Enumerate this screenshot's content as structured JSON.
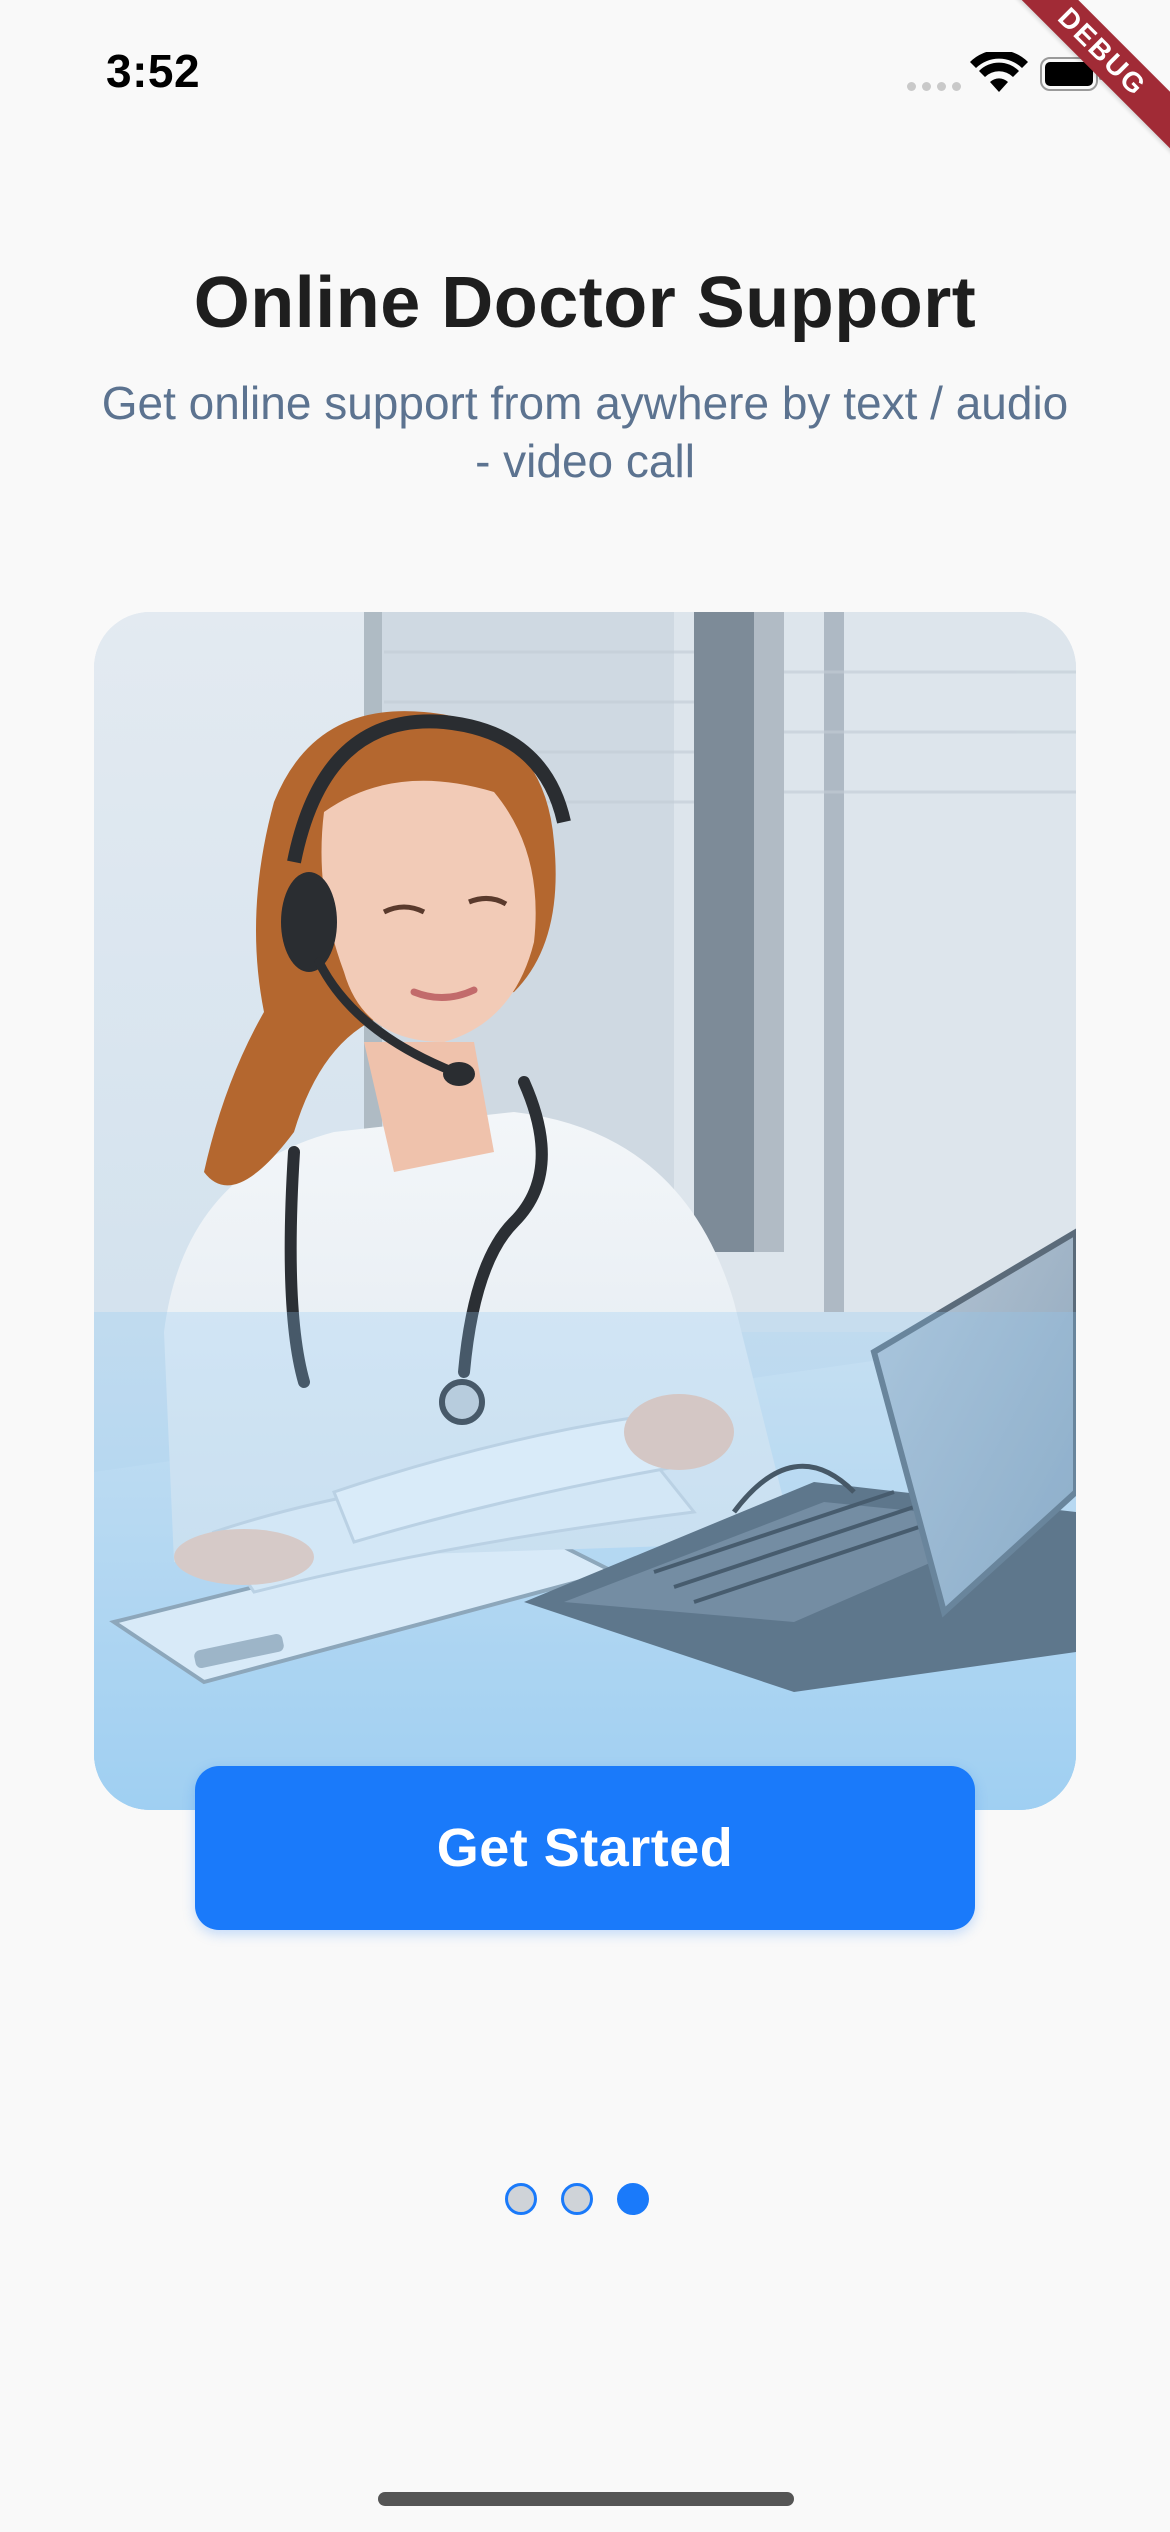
{
  "status_bar": {
    "time": "3:52"
  },
  "debug_banner": {
    "label": "DEBUG"
  },
  "onboarding": {
    "title": "Online Doctor Support",
    "subtitle": "Get online support from aywhere by text / audio - video call",
    "hero_image": "doctor-with-headset-at-laptop-illustration",
    "button_label": "Get Started",
    "page_indicator": {
      "total_pages": 3,
      "current_page": 3
    }
  },
  "colors": {
    "background": "#f9f9f9",
    "accent": "#1a7afa",
    "subtitle": "#5c7390",
    "debug_ribbon": "#a12b36",
    "inactive_dot": "#cfd3d8"
  }
}
